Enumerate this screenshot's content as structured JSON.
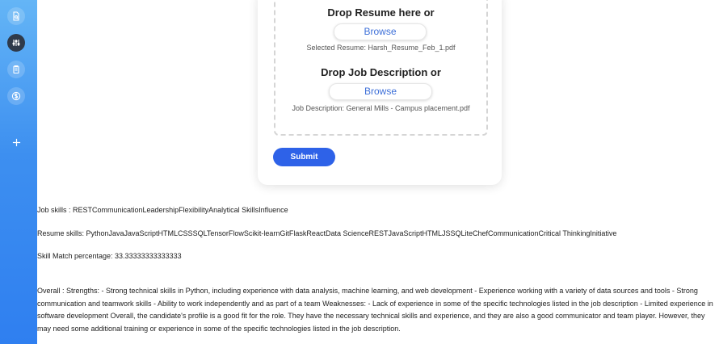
{
  "sidebar": {
    "icons": [
      "document-search-icon",
      "sliders-icon",
      "clipboard-icon",
      "dollar-icon",
      "plus-icon"
    ],
    "active_index": 1
  },
  "upload": {
    "resume_title": "Drop Resume here or",
    "resume_browse": "Browse",
    "resume_selected": "Selected Resume: Harsh_Resume_Feb_1.pdf",
    "jd_title": "Drop Job Description or",
    "jd_browse": "Browse",
    "jd_selected": "Job Description: General Mills - Campus placement.pdf",
    "submit": "Submit"
  },
  "results": {
    "job_skills": "Job skills : RESTCommunicationLeadershipFlexibilityAnalytical SkillsInfluence",
    "resume_skills": "Resume skills: PythonJavaJavaScriptHTMLCSSSQLTensorFlowScikit-learnGitFlaskReactData ScienceRESTJavaScriptHTMLJSSQLiteChefCommunicationCritical ThinkingInitiative",
    "skill_match": "Skill Match percentage: 33.33333333333333",
    "overall": "Overall : Strengths: - Strong technical skills in Python, including experience with data analysis, machine learning, and web development - Experience working with a variety of data sources and tools - Strong communication and teamwork skills - Ability to work independently and as part of a team Weaknesses: - Lack of experience in some of the specific technologies listed in the job description - Limited experience in software development Overall, the candidate's profile is a good fit for the role. They have the necessary technical skills and experience, and they are also a good communicator and team player. However, they may need some additional training or experience in some of the specific technologies listed in the job description."
  },
  "colors": {
    "sidebar_top": "#64b5f6",
    "sidebar_bottom": "#2f7ff0",
    "accent": "#2e62e8",
    "active_icon_bg": "#2f3a4a"
  }
}
